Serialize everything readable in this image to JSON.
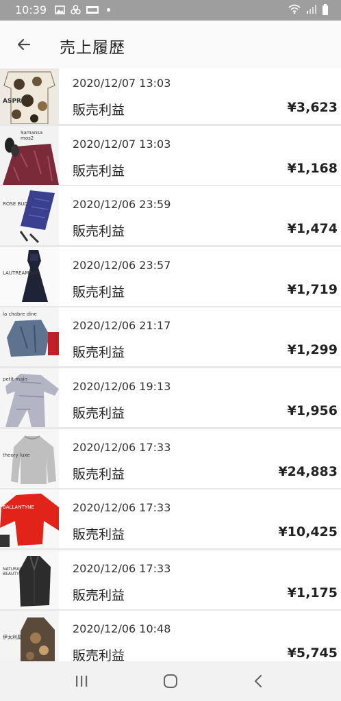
{
  "status_bar": {
    "time": "10:39",
    "icons": [
      "image-icon",
      "pinwheel-icon",
      "notification-badge-icon",
      "dot-icon",
      "wifi-icon",
      "signal-icon",
      "battery-icon"
    ]
  },
  "header": {
    "title": "売上履歴",
    "back_icon": "arrow-left-icon"
  },
  "sales": [
    {
      "date": "2020/12/07 13:03",
      "type": "販売利益",
      "amount": "¥3,623",
      "thumb_label": "ASPRI"
    },
    {
      "date": "2020/12/07 13:03",
      "type": "販売利益",
      "amount": "¥1,168",
      "thumb_label": "Samansa mos2"
    },
    {
      "date": "2020/12/06 23:59",
      "type": "販売利益",
      "amount": "¥1,474",
      "thumb_label": "ROSE BUD"
    },
    {
      "date": "2020/12/06 23:57",
      "type": "販売利益",
      "amount": "¥1,719",
      "thumb_label": "LAUTREAMONT"
    },
    {
      "date": "2020/12/06 21:17",
      "type": "販売利益",
      "amount": "¥1,299",
      "thumb_label": "la chabre dine"
    },
    {
      "date": "2020/12/06 19:13",
      "type": "販売利益",
      "amount": "¥1,956",
      "thumb_label": "petit main"
    },
    {
      "date": "2020/12/06 17:33",
      "type": "販売利益",
      "amount": "¥24,883",
      "thumb_label": "theory luxe"
    },
    {
      "date": "2020/12/06 17:33",
      "type": "販売利益",
      "amount": "¥10,425",
      "thumb_label": "BALLANTYNE"
    },
    {
      "date": "2020/12/06 17:33",
      "type": "販売利益",
      "amount": "¥1,175",
      "thumb_label": "NATURAL BEAUTY"
    },
    {
      "date": "2020/12/06 10:48",
      "type": "販売利益",
      "amount": "¥5,745",
      "thumb_label": "伊太利屋"
    }
  ],
  "nav_bar": {
    "icons": [
      "recent-apps-icon",
      "home-icon",
      "back-nav-icon"
    ]
  },
  "colors": {
    "status_bar": "#9e9e9e",
    "app_bar": "#fafafa",
    "divider": "#e8e8e8",
    "nav_bar": "#f2f2f2"
  }
}
